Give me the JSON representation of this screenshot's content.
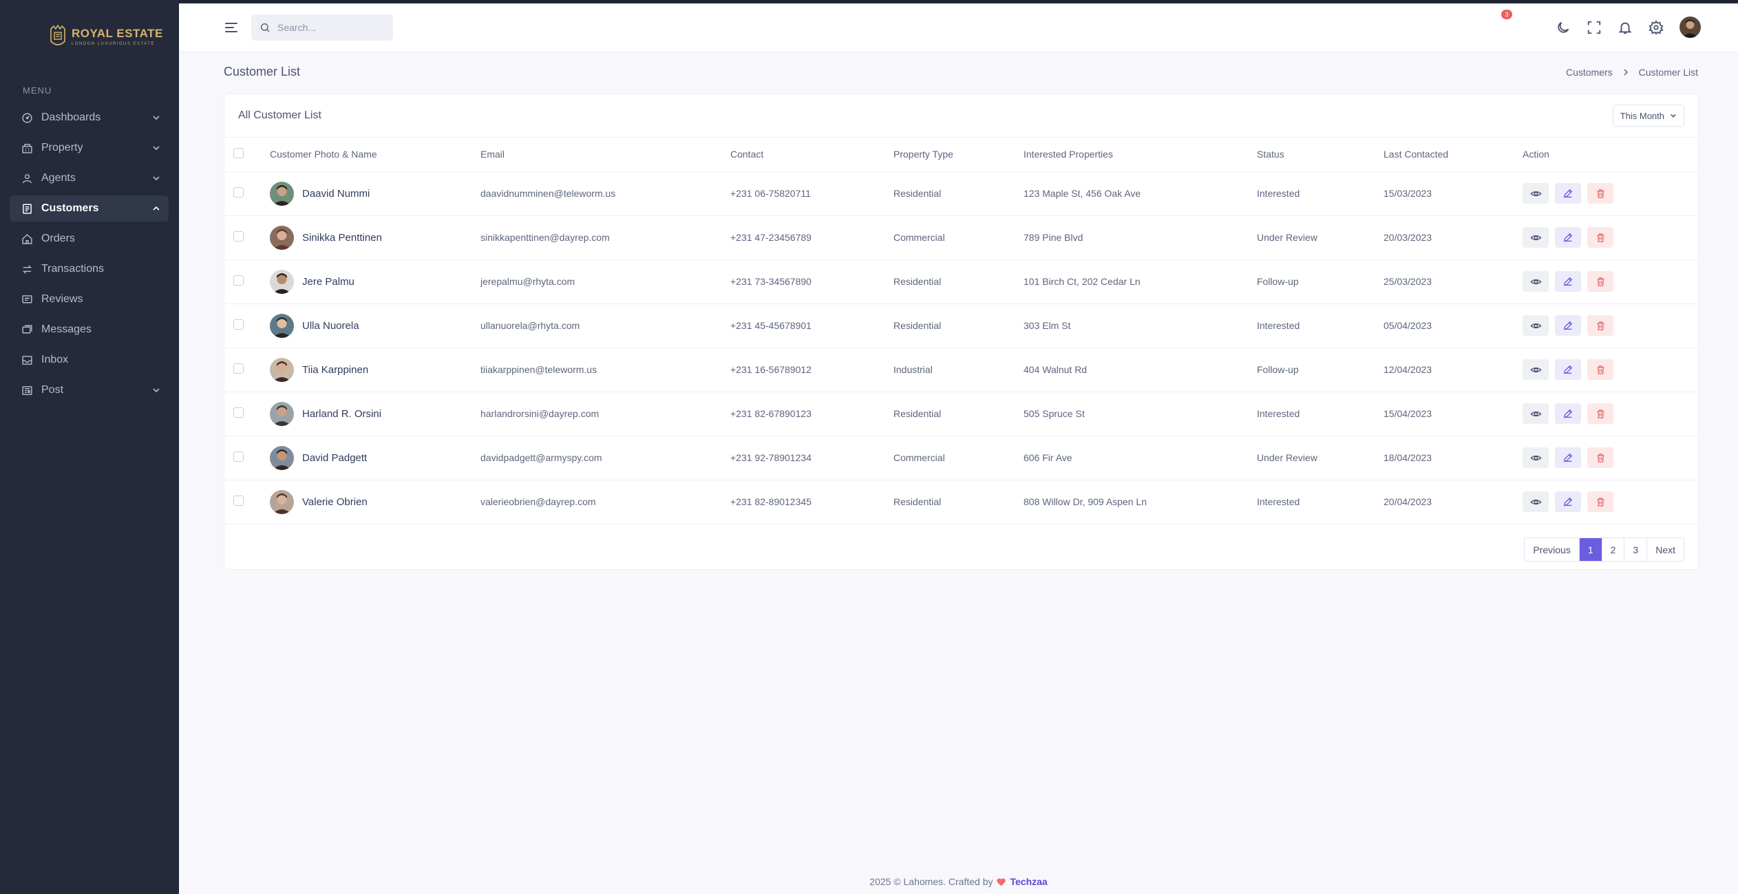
{
  "brand": {
    "title": "ROYAL ESTATE",
    "subtitle": "LONDON LUXURIOUS ESTATE"
  },
  "sidebar": {
    "heading": "MENU",
    "items": [
      {
        "label": "Dashboards",
        "icon": "dashboard-icon",
        "chevron": "down"
      },
      {
        "label": "Property",
        "icon": "building-icon",
        "chevron": "down"
      },
      {
        "label": "Agents",
        "icon": "user-icon",
        "chevron": "down"
      },
      {
        "label": "Customers",
        "icon": "address-book-icon",
        "chevron": "up",
        "active": true
      },
      {
        "label": "Orders",
        "icon": "home-icon"
      },
      {
        "label": "Transactions",
        "icon": "arrows-swap-icon"
      },
      {
        "label": "Reviews",
        "icon": "chat-square-icon"
      },
      {
        "label": "Messages",
        "icon": "messages-icon"
      },
      {
        "label": "Inbox",
        "icon": "inbox-icon"
      },
      {
        "label": "Post",
        "icon": "newspaper-icon",
        "chevron": "down"
      }
    ]
  },
  "topbar": {
    "search_placeholder": "Search...",
    "notification_count": "3"
  },
  "page": {
    "title": "Customer List",
    "breadcrumb": [
      "Customers",
      "Customer List"
    ]
  },
  "card": {
    "title": "All Customer List",
    "filter_label": "This Month"
  },
  "table": {
    "headers": [
      "Customer Photo & Name",
      "Email",
      "Contact",
      "Property Type",
      "Interested Properties",
      "Status",
      "Last Contacted",
      "Action"
    ],
    "rows": [
      {
        "name": "Daavid Nummi",
        "email": "daavidnumminen@teleworm.us",
        "contact": "+231 06-75820711",
        "type": "Residential",
        "properties": "123 Maple St, 456 Oak Ave",
        "status": "Interested",
        "date": "15/03/2023"
      },
      {
        "name": "Sinikka Penttinen",
        "email": "sinikkapenttinen@dayrep.com",
        "contact": "+231 47-23456789",
        "type": "Commercial",
        "properties": "789 Pine Blvd",
        "status": "Under Review",
        "date": "20/03/2023"
      },
      {
        "name": "Jere Palmu",
        "email": "jerepalmu@rhyta.com",
        "contact": "+231 73-34567890",
        "type": "Residential",
        "properties": "101 Birch Ct, 202 Cedar Ln",
        "status": "Follow-up",
        "date": "25/03/2023"
      },
      {
        "name": "Ulla Nuorela",
        "email": "ullanuorela@rhyta.com",
        "contact": "+231 45-45678901",
        "type": "Residential",
        "properties": "303 Elm St",
        "status": "Interested",
        "date": "05/04/2023"
      },
      {
        "name": "Tiia Karppinen",
        "email": "tiiakarppinen@teleworm.us",
        "contact": "+231 16-56789012",
        "type": "Industrial",
        "properties": "404 Walnut Rd",
        "status": "Follow-up",
        "date": "12/04/2023"
      },
      {
        "name": "Harland R. Orsini",
        "email": "harlandrorsini@dayrep.com",
        "contact": "+231 82-67890123",
        "type": "Residential",
        "properties": "505 Spruce St",
        "status": "Interested",
        "date": "15/04/2023"
      },
      {
        "name": "David Padgett",
        "email": "davidpadgett@armyspy.com",
        "contact": "+231 92-78901234",
        "type": "Commercial",
        "properties": "606 Fir Ave",
        "status": "Under Review",
        "date": "18/04/2023"
      },
      {
        "name": "Valerie Obrien",
        "email": "valerieobrien@dayrep.com",
        "contact": "+231 82-89012345",
        "type": "Residential",
        "properties": "808 Willow Dr, 909 Aspen Ln",
        "status": "Interested",
        "date": "20/04/2023"
      }
    ]
  },
  "pagination": {
    "previous": "Previous",
    "pages": [
      "1",
      "2",
      "3"
    ],
    "active": "1",
    "next": "Next"
  },
  "footer": {
    "text": "2025 © Lahomes. Crafted by",
    "brand": "Techzaa"
  },
  "colors": {
    "sidebar_bg": "#242a3a",
    "accent": "#6b5ce0",
    "danger": "#ef5f5f",
    "gold": "#d8b46a"
  }
}
